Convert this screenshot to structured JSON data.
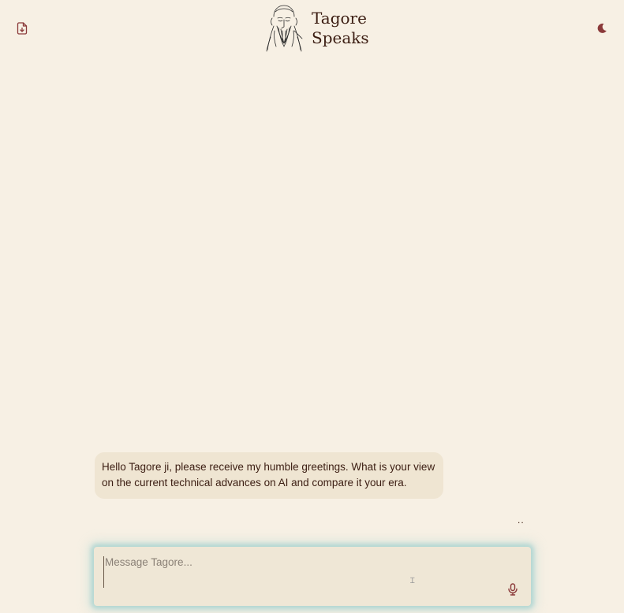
{
  "header": {
    "title_line1": "Tagore",
    "title_line2": "Speaks",
    "icons": {
      "left": "file-download-icon",
      "right": "moon-icon",
      "logo": "tagore-portrait"
    }
  },
  "messages": [
    {
      "role": "user",
      "text": "Hello Tagore ji, please receive my humble greetings. What is your view on the current technical advances on AI and compare it your era."
    }
  ],
  "typing_indicator": "..",
  "composer": {
    "placeholder": "Message Tagore...",
    "value": "",
    "mic_icon": "mic-icon"
  },
  "colors": {
    "background": "#f7f0e4",
    "accent": "#8b3a3a",
    "text": "#3b1d12",
    "bubble": "#efe5d2",
    "composer_glow": "#8cc8c8"
  }
}
